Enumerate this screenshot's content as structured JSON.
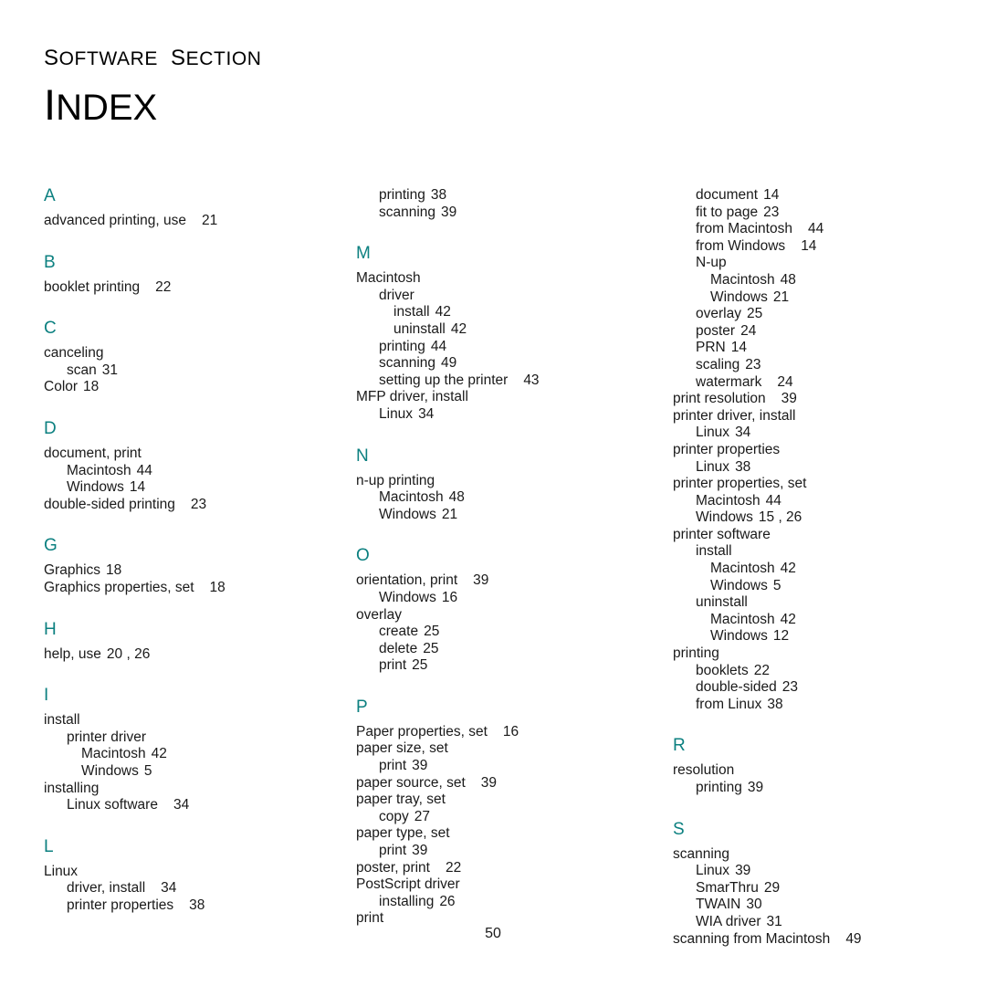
{
  "header": {
    "kicker_first": "S",
    "kicker_rest": "OFTWARE",
    "kicker_second_first": "S",
    "kicker_second_rest": "ECTION",
    "title_first": "I",
    "title_rest": "NDEX"
  },
  "footer": {
    "page_number": "50"
  },
  "colors": {
    "letter_heading": "#0c8080",
    "body_text": "#1a1a1a",
    "background": "#ffffff"
  },
  "columns": [
    {
      "id": "column-1",
      "blocks": [
        {
          "letter": "A",
          "entries": [
            {
              "level": 0,
              "text": "advanced printing, use",
              "pages": "21",
              "gap": "wide"
            }
          ]
        },
        {
          "letter": "B",
          "entries": [
            {
              "level": 0,
              "text": "booklet printing",
              "pages": "22",
              "gap": "wide"
            }
          ]
        },
        {
          "letter": "C",
          "entries": [
            {
              "level": 0,
              "text": "canceling",
              "pages": "",
              "gap": "none"
            },
            {
              "level": 1,
              "text": "scan",
              "pages": "31",
              "gap": "narrow"
            },
            {
              "level": 0,
              "text": "Color",
              "pages": "18",
              "gap": "narrow"
            }
          ]
        },
        {
          "letter": "D",
          "entries": [
            {
              "level": 0,
              "text": "document, print",
              "pages": "",
              "gap": "none"
            },
            {
              "level": 1,
              "text": "Macintosh",
              "pages": "44",
              "gap": "narrow"
            },
            {
              "level": 1,
              "text": "Windows",
              "pages": "14",
              "gap": "narrow"
            },
            {
              "level": 0,
              "text": "double-sided printing",
              "pages": "23",
              "gap": "wide"
            }
          ]
        },
        {
          "letter": "G",
          "entries": [
            {
              "level": 0,
              "text": "Graphics",
              "pages": "18",
              "gap": "narrow"
            },
            {
              "level": 0,
              "text": "Graphics properties, set",
              "pages": "18",
              "gap": "wide"
            }
          ]
        },
        {
          "letter": "H",
          "entries": [
            {
              "level": 0,
              "text": "help, use",
              "pages": "20 , 26",
              "gap": "narrow"
            }
          ]
        },
        {
          "letter": "I",
          "entries": [
            {
              "level": 0,
              "text": "install",
              "pages": "",
              "gap": "none"
            },
            {
              "level": 1,
              "text": "printer driver",
              "pages": "",
              "gap": "none"
            },
            {
              "level": 2,
              "text": "Macintosh",
              "pages": "42",
              "gap": "narrow"
            },
            {
              "level": 2,
              "text": "Windows",
              "pages": "5",
              "gap": "narrow"
            },
            {
              "level": 0,
              "text": "installing",
              "pages": "",
              "gap": "none"
            },
            {
              "level": 1,
              "text": "Linux software",
              "pages": "34",
              "gap": "wide"
            }
          ]
        },
        {
          "letter": "L",
          "entries": [
            {
              "level": 0,
              "text": "Linux",
              "pages": "",
              "gap": "none"
            },
            {
              "level": 1,
              "text": "driver, install",
              "pages": "34",
              "gap": "wide"
            },
            {
              "level": 1,
              "text": "printer properties",
              "pages": "38",
              "gap": "wide"
            }
          ]
        }
      ]
    },
    {
      "id": "column-2",
      "blocks": [
        {
          "letter": "",
          "entries": [
            {
              "level": 1,
              "text": "printing",
              "pages": "38",
              "gap": "narrow"
            },
            {
              "level": 1,
              "text": "scanning",
              "pages": "39",
              "gap": "narrow"
            }
          ]
        },
        {
          "letter": "M",
          "entries": [
            {
              "level": 0,
              "text": "Macintosh",
              "pages": "",
              "gap": "none"
            },
            {
              "level": 1,
              "text": "driver",
              "pages": "",
              "gap": "none"
            },
            {
              "level": 2,
              "text": "install",
              "pages": "42",
              "gap": "narrow"
            },
            {
              "level": 2,
              "text": "uninstall",
              "pages": "42",
              "gap": "narrow"
            },
            {
              "level": 1,
              "text": "printing",
              "pages": "44",
              "gap": "narrow"
            },
            {
              "level": 1,
              "text": "scanning",
              "pages": "49",
              "gap": "narrow"
            },
            {
              "level": 1,
              "text": "setting up the printer",
              "pages": "43",
              "gap": "wide"
            },
            {
              "level": 0,
              "text": "MFP driver, install",
              "pages": "",
              "gap": "none"
            },
            {
              "level": 1,
              "text": "Linux",
              "pages": "34",
              "gap": "narrow"
            }
          ]
        },
        {
          "letter": "N",
          "entries": [
            {
              "level": 0,
              "text": "n-up printing",
              "pages": "",
              "gap": "none"
            },
            {
              "level": 1,
              "text": "Macintosh",
              "pages": "48",
              "gap": "narrow"
            },
            {
              "level": 1,
              "text": "Windows",
              "pages": "21",
              "gap": "narrow"
            }
          ]
        },
        {
          "letter": "O",
          "entries": [
            {
              "level": 0,
              "text": "orientation, print",
              "pages": "39",
              "gap": "wide"
            },
            {
              "level": 1,
              "text": "Windows",
              "pages": "16",
              "gap": "narrow"
            },
            {
              "level": 0,
              "text": "overlay",
              "pages": "",
              "gap": "none"
            },
            {
              "level": 1,
              "text": "create",
              "pages": "25",
              "gap": "narrow"
            },
            {
              "level": 1,
              "text": "delete",
              "pages": "25",
              "gap": "narrow"
            },
            {
              "level": 1,
              "text": "print",
              "pages": "25",
              "gap": "narrow"
            }
          ]
        },
        {
          "letter": "P",
          "entries": [
            {
              "level": 0,
              "text": "Paper properties, set",
              "pages": "16",
              "gap": "wide"
            },
            {
              "level": 0,
              "text": "paper size, set",
              "pages": "",
              "gap": "none"
            },
            {
              "level": 1,
              "text": "print",
              "pages": "39",
              "gap": "narrow"
            },
            {
              "level": 0,
              "text": "paper source, set",
              "pages": "39",
              "gap": "wide"
            },
            {
              "level": 0,
              "text": "paper tray, set",
              "pages": "",
              "gap": "none"
            },
            {
              "level": 1,
              "text": "copy",
              "pages": "27",
              "gap": "narrow"
            },
            {
              "level": 0,
              "text": "paper type, set",
              "pages": "",
              "gap": "none"
            },
            {
              "level": 1,
              "text": "print",
              "pages": "39",
              "gap": "narrow"
            },
            {
              "level": 0,
              "text": "poster, print",
              "pages": "22",
              "gap": "wide"
            },
            {
              "level": 0,
              "text": "PostScript driver",
              "pages": "",
              "gap": "none"
            },
            {
              "level": 1,
              "text": "installing",
              "pages": "26",
              "gap": "narrow"
            },
            {
              "level": 0,
              "text": "print",
              "pages": "",
              "gap": "none"
            }
          ]
        }
      ]
    },
    {
      "id": "column-3",
      "blocks": [
        {
          "letter": "",
          "entries": [
            {
              "level": 1,
              "text": "document",
              "pages": "14",
              "gap": "narrow"
            },
            {
              "level": 1,
              "text": "fit to page",
              "pages": "23",
              "gap": "narrow"
            },
            {
              "level": 1,
              "text": "from Macintosh",
              "pages": "44",
              "gap": "wide"
            },
            {
              "level": 1,
              "text": "from Windows",
              "pages": "14",
              "gap": "wide"
            },
            {
              "level": 1,
              "text": "N-up",
              "pages": "",
              "gap": "none"
            },
            {
              "level": 2,
              "text": "Macintosh",
              "pages": "48",
              "gap": "narrow"
            },
            {
              "level": 2,
              "text": "Windows",
              "pages": "21",
              "gap": "narrow"
            },
            {
              "level": 1,
              "text": "overlay",
              "pages": "25",
              "gap": "narrow"
            },
            {
              "level": 1,
              "text": "poster",
              "pages": "24",
              "gap": "narrow"
            },
            {
              "level": 1,
              "text": "PRN",
              "pages": "14",
              "gap": "narrow"
            },
            {
              "level": 1,
              "text": "scaling",
              "pages": "23",
              "gap": "narrow"
            },
            {
              "level": 1,
              "text": "watermark",
              "pages": "24",
              "gap": "wide"
            },
            {
              "level": 0,
              "text": "print resolution",
              "pages": "39",
              "gap": "wide"
            },
            {
              "level": 0,
              "text": "printer driver, install",
              "pages": "",
              "gap": "none"
            },
            {
              "level": 1,
              "text": "Linux",
              "pages": "34",
              "gap": "narrow"
            },
            {
              "level": 0,
              "text": "printer properties",
              "pages": "",
              "gap": "none"
            },
            {
              "level": 1,
              "text": "Linux",
              "pages": "38",
              "gap": "narrow"
            },
            {
              "level": 0,
              "text": "printer properties, set",
              "pages": "",
              "gap": "none"
            },
            {
              "level": 1,
              "text": "Macintosh",
              "pages": "44",
              "gap": "narrow"
            },
            {
              "level": 1,
              "text": "Windows",
              "pages": "15 , 26",
              "gap": "narrow"
            },
            {
              "level": 0,
              "text": "printer software",
              "pages": "",
              "gap": "none"
            },
            {
              "level": 1,
              "text": "install",
              "pages": "",
              "gap": "none"
            },
            {
              "level": 2,
              "text": "Macintosh",
              "pages": "42",
              "gap": "narrow"
            },
            {
              "level": 2,
              "text": "Windows",
              "pages": "5",
              "gap": "narrow"
            },
            {
              "level": 1,
              "text": "uninstall",
              "pages": "",
              "gap": "none"
            },
            {
              "level": 2,
              "text": "Macintosh",
              "pages": "42",
              "gap": "narrow"
            },
            {
              "level": 2,
              "text": "Windows",
              "pages": "12",
              "gap": "narrow"
            },
            {
              "level": 0,
              "text": "printing",
              "pages": "",
              "gap": "none"
            },
            {
              "level": 1,
              "text": "booklets",
              "pages": "22",
              "gap": "narrow"
            },
            {
              "level": 1,
              "text": "double-sided",
              "pages": "23",
              "gap": "narrow"
            },
            {
              "level": 1,
              "text": "from Linux",
              "pages": "38",
              "gap": "narrow"
            }
          ]
        },
        {
          "letter": "R",
          "entries": [
            {
              "level": 0,
              "text": "resolution",
              "pages": "",
              "gap": "none"
            },
            {
              "level": 1,
              "text": "printing",
              "pages": "39",
              "gap": "narrow"
            }
          ]
        },
        {
          "letter": "S",
          "entries": [
            {
              "level": 0,
              "text": "scanning",
              "pages": "",
              "gap": "none"
            },
            {
              "level": 1,
              "text": "Linux",
              "pages": "39",
              "gap": "narrow"
            },
            {
              "level": 1,
              "text": "SmarThru",
              "pages": "29",
              "gap": "narrow"
            },
            {
              "level": 1,
              "text": "TWAIN",
              "pages": "30",
              "gap": "narrow"
            },
            {
              "level": 1,
              "text": "WIA driver",
              "pages": "31",
              "gap": "narrow"
            },
            {
              "level": 0,
              "text": "scanning from Macintosh",
              "pages": "49",
              "gap": "wide"
            }
          ]
        }
      ]
    }
  ]
}
